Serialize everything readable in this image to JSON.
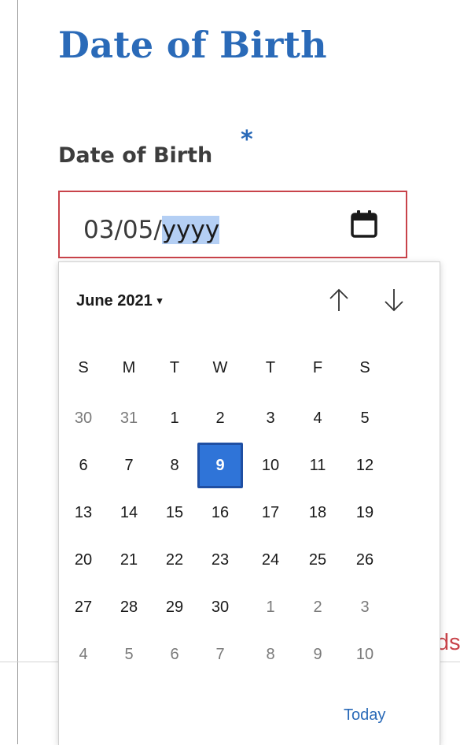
{
  "page": {
    "title": "Date of Birth"
  },
  "field": {
    "label": "Date of Birth",
    "required_mark": "*",
    "value_prefix": "03/05/",
    "value_selected": "yyyy",
    "icon": "calendar-icon"
  },
  "error_fragment": "ds.",
  "calendar": {
    "month_label": "June 2021",
    "caret": "▾",
    "nav": {
      "up": "arrow-up-icon",
      "down": "arrow-down-icon"
    },
    "weekdays": [
      "S",
      "M",
      "T",
      "W",
      "T",
      "F",
      "S"
    ],
    "weeks": [
      [
        {
          "d": "30",
          "o": true
        },
        {
          "d": "31",
          "o": true
        },
        {
          "d": "1"
        },
        {
          "d": "2"
        },
        {
          "d": "3"
        },
        {
          "d": "4"
        },
        {
          "d": "5"
        }
      ],
      [
        {
          "d": "6"
        },
        {
          "d": "7"
        },
        {
          "d": "8"
        },
        {
          "d": "9",
          "s": true
        },
        {
          "d": "10"
        },
        {
          "d": "11"
        },
        {
          "d": "12"
        }
      ],
      [
        {
          "d": "13"
        },
        {
          "d": "14"
        },
        {
          "d": "15"
        },
        {
          "d": "16"
        },
        {
          "d": "17"
        },
        {
          "d": "18"
        },
        {
          "d": "19"
        }
      ],
      [
        {
          "d": "20"
        },
        {
          "d": "21"
        },
        {
          "d": "22"
        },
        {
          "d": "23"
        },
        {
          "d": "24"
        },
        {
          "d": "25"
        },
        {
          "d": "26"
        }
      ],
      [
        {
          "d": "27"
        },
        {
          "d": "28"
        },
        {
          "d": "29"
        },
        {
          "d": "30"
        },
        {
          "d": "1",
          "o": true
        },
        {
          "d": "2",
          "o": true
        },
        {
          "d": "3",
          "o": true
        }
      ],
      [
        {
          "d": "4",
          "o": true
        },
        {
          "d": "5",
          "o": true
        },
        {
          "d": "6",
          "o": true
        },
        {
          "d": "7",
          "o": true
        },
        {
          "d": "8",
          "o": true
        },
        {
          "d": "9",
          "o": true
        },
        {
          "d": "10",
          "o": true
        }
      ]
    ],
    "today_label": "Today"
  },
  "colors": {
    "heading_blue": "#2a6ab8",
    "error_red": "#c8434a",
    "selected_day": "#2f74d8",
    "text_selection": "#b4cff4"
  }
}
